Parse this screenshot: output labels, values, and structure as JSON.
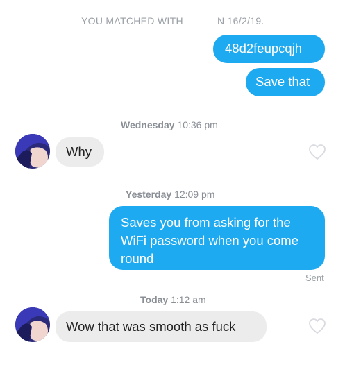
{
  "header": {
    "matched_prefix": "YOU MATCHED WITH",
    "matched_suffix": "N 16/2/19."
  },
  "messages": [
    {
      "text": "48d2feupcqjh",
      "direction": "sent"
    },
    {
      "text": "Save that",
      "direction": "sent"
    },
    {
      "text": "Why",
      "direction": "received"
    },
    {
      "text": "Saves you from asking for the WiFi password when you come round",
      "direction": "sent",
      "lines": [
        "Saves you from asking for the",
        "WiFi password when you come",
        "round"
      ]
    },
    {
      "text": "Wow that was smooth as fuck",
      "direction": "received"
    }
  ],
  "timestamps": [
    {
      "day": "Wednesday",
      "time": "10:36 pm"
    },
    {
      "day": "Yesterday",
      "time": "12:09 pm"
    },
    {
      "day": "Today",
      "time": "1:12 am"
    }
  ],
  "status": {
    "sent": "Sent"
  },
  "colors": {
    "sent_bubble": "#1eaaf1",
    "received_bubble": "#ececec",
    "timestamp": "#8a8f96"
  },
  "icons": {
    "like": "heart-outline-icon",
    "avatar": "profile-photo"
  }
}
